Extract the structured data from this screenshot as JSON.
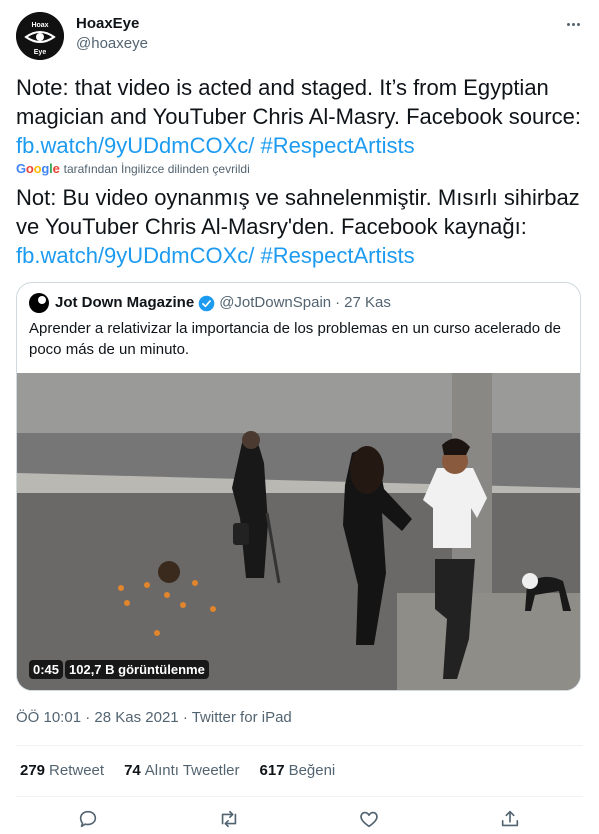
{
  "author": {
    "display_name": "HoaxEye",
    "handle": "@hoaxeye",
    "avatar_text": "Hoax Eye"
  },
  "tweet": {
    "text_before": "Note: that video is acted and staged. It’s from Egyptian magician and YouTuber Chris Al-Masry. Facebook source: ",
    "link": "fb.watch/9yUDdmCOXc/",
    "hashtag": "#RespectArtists"
  },
  "translation": {
    "google_logo": "Google",
    "note": "tarafından İngilizce dilinden çevrildi",
    "text_before": "Not: Bu video oynanmış ve sahnelenmiştir. Mısırlı sihirbaz ve YouTuber Chris Al-Masry'den. Facebook kaynağı: ",
    "link": "fb.watch/9yUDdmCOXc/",
    "hashtag": "#RespectArtists"
  },
  "quote": {
    "name": "Jot Down Magazine",
    "handle": "@JotDownSpain",
    "separator": "·",
    "date": "27 Kas",
    "text": "Aprender a relativizar la importancia de los problemas en un curso acelerado de poco más de un minuto.",
    "video": {
      "duration": "0:45",
      "views": "102,7 B görüntülenme"
    }
  },
  "meta": {
    "time": "ÖÖ 10:01",
    "separator": "·",
    "date": "28 Kas 2021",
    "source": "Twitter for iPad"
  },
  "stats": {
    "retweets": {
      "count": "279",
      "label": "Retweet"
    },
    "quotes": {
      "count": "74",
      "label": "Alıntı Tweetler"
    },
    "likes": {
      "count": "617",
      "label": "Beğeni"
    }
  },
  "icons": [
    "more-icon",
    "verified-icon",
    "reply-icon",
    "retweet-icon",
    "like-icon",
    "share-icon"
  ],
  "colors": {
    "link": "#1d9bf0",
    "secondary_text": "#536471",
    "verified": "#1d9bf0"
  }
}
